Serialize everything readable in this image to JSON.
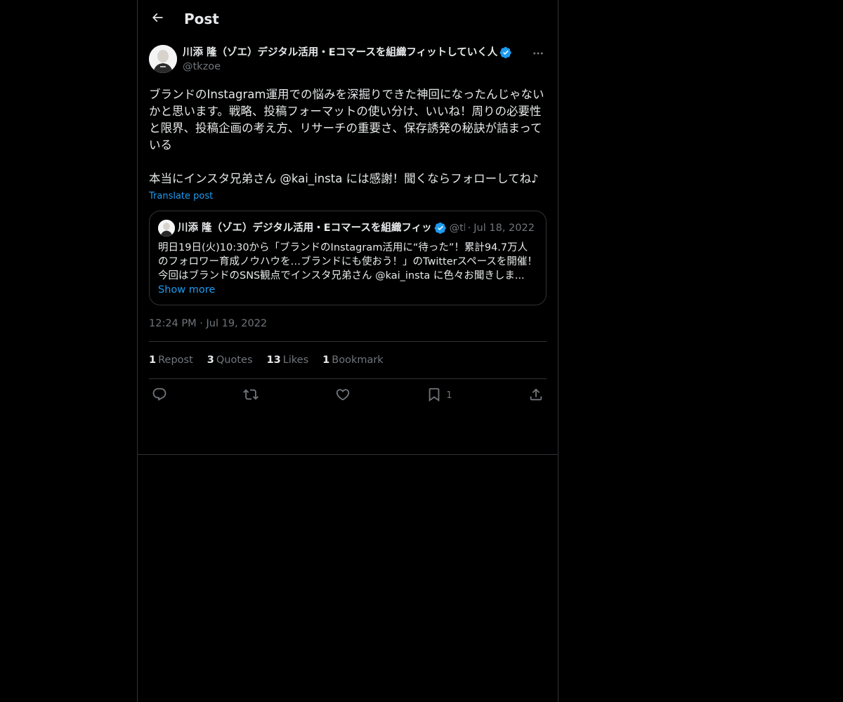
{
  "header": {
    "title": "Post"
  },
  "post": {
    "author_name": "川添 隆（ゾエ）デジタル活用・Eコマースを組織フィットしていく人",
    "handle": "@tkzoe",
    "text": "ブランドのInstagram運用での悩みを深掘りできた神回になったんじゃないかと思います。戦略、投稿フォーマットの使い分け、いいね！周りの必要性と限界、投稿企画の考え方、リサーチの重要さ、保存誘発の秘訣が詰まっている\n\n本当にインスタ兄弟さん @kai_insta には感謝！聞くならフォローしてね♪",
    "translate_label": "Translate post",
    "timestamp": "12:24 PM",
    "date": "Jul 19, 2022"
  },
  "quote": {
    "author_name": "川添 隆（ゾエ）デジタル活用・Eコマースを組織フィッ",
    "handle": "@tk",
    "date": "Jul 18, 2022",
    "text": "明日19日(火)10:30から「ブランドのInstagram活用に“待った”！累計94.7万人のフォロワー育成ノウハウを…ブランドにも使おう！」のTwitterスペースを開催！\n",
    "last_line": "今回はブランドのSNS観点でインスタ兄弟さん @kai_insta に色々お聞きしま...",
    "show_more": "Show more"
  },
  "stats": [
    {
      "count": "1",
      "label": "Repost"
    },
    {
      "count": "3",
      "label": "Quotes"
    },
    {
      "count": "13",
      "label": "Likes"
    },
    {
      "count": "1",
      "label": "Bookmark"
    }
  ],
  "actions": {
    "bookmark_count": "1"
  },
  "colors": {
    "background": "#000000",
    "text": "#e7e9ea",
    "muted": "#71767b",
    "accent": "#1d9bf0",
    "border": "#2f3336"
  }
}
